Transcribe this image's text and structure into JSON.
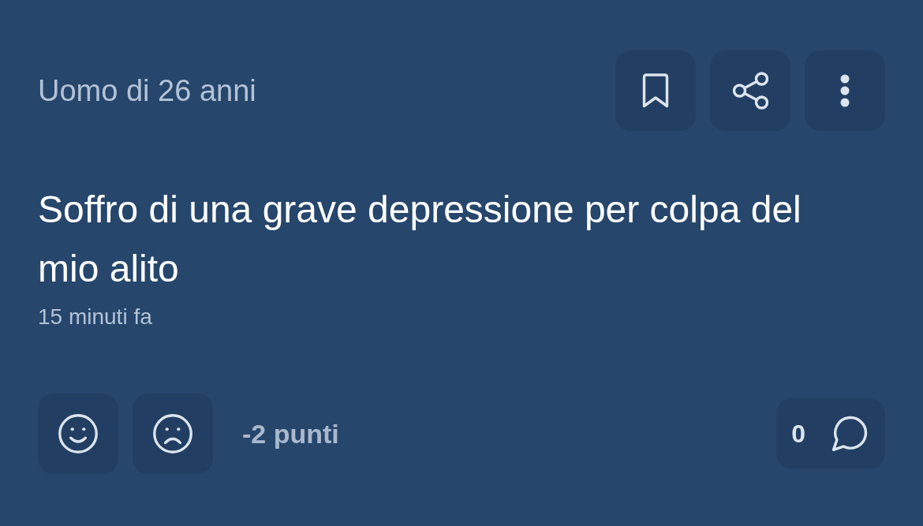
{
  "post": {
    "author": "Uomo di 26 anni",
    "actions": [
      {
        "kind": "bookmark"
      },
      {
        "kind": "share"
      },
      {
        "kind": "more"
      }
    ],
    "title": "Soffro di una grave depressione per colpa del mio alito",
    "time": "15 minuti fa"
  },
  "votes": {
    "buttons": [
      {
        "kind": "like"
      },
      {
        "kind": "dislike"
      }
    ],
    "score": "-2 punti"
  },
  "comments": {
    "count": "0"
  }
}
